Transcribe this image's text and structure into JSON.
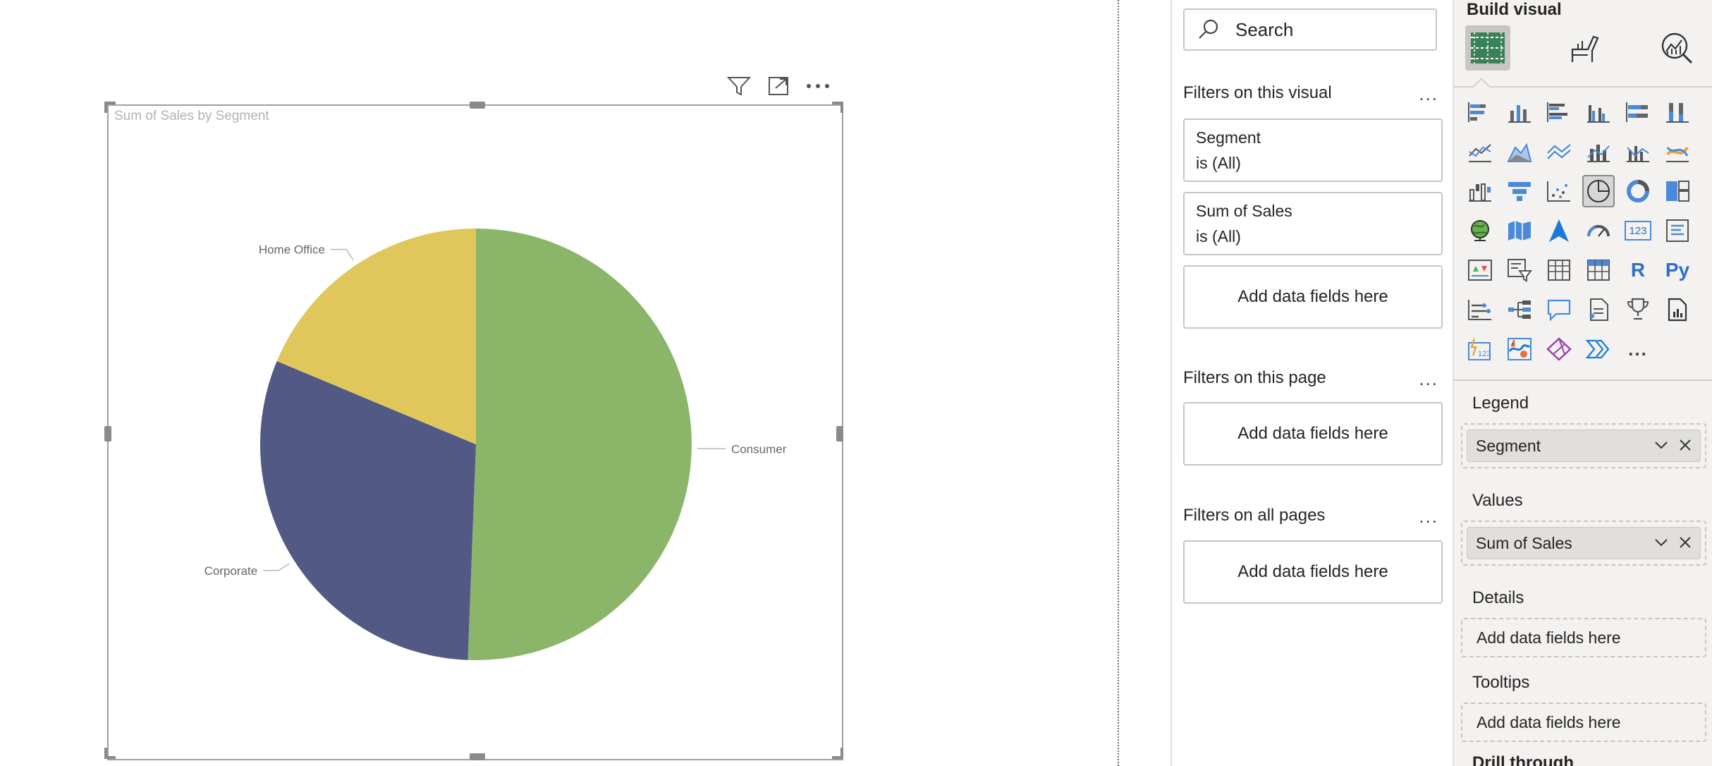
{
  "visual": {
    "title": "Sum of Sales by Segment",
    "header_icons": [
      "filter-icon",
      "focus-mode-icon",
      "more-options-icon"
    ]
  },
  "chart_data": {
    "type": "pie",
    "title": "Sum of Sales by Segment",
    "categories": [
      "Consumer",
      "Corporate",
      "Home Office"
    ],
    "values": [
      50.6,
      30.7,
      18.7
    ],
    "value_unit": "percent of total",
    "colors": [
      "#8bb66a",
      "#525985",
      "#dfc75c"
    ],
    "labels_shown": [
      "Consumer",
      "Corporate",
      "Home Office"
    ]
  },
  "filters_pane": {
    "search_placeholder": "Search",
    "on_visual": {
      "title": "Filters on this visual",
      "more": "...",
      "cards": [
        {
          "line1": "Segment",
          "line2": "is (All)"
        },
        {
          "line1": "Sum of Sales",
          "line2": "is (All)"
        }
      ],
      "add": "Add data fields here"
    },
    "on_page": {
      "title": "Filters on this page",
      "more": "...",
      "add": "Add data fields here"
    },
    "on_all_pages": {
      "title": "Filters on all pages",
      "more": "...",
      "add": "Add data fields here"
    }
  },
  "build_pane": {
    "title": "Build visual",
    "tabs": [
      "build-visual-tab",
      "format-visual-tab",
      "analytics-tab"
    ],
    "visual_icons_text": {
      "card": "123",
      "r": "R",
      "py": "Py",
      "more": "..."
    },
    "selected_visual": "pie-chart",
    "wells": {
      "legend": {
        "title": "Legend",
        "field": "Segment"
      },
      "values": {
        "title": "Values",
        "field": "Sum of Sales"
      },
      "details": {
        "title": "Details",
        "add": "Add data fields here"
      },
      "tooltips": {
        "title": "Tooltips",
        "add": "Add data fields here"
      },
      "next_title": "Drill through"
    }
  }
}
